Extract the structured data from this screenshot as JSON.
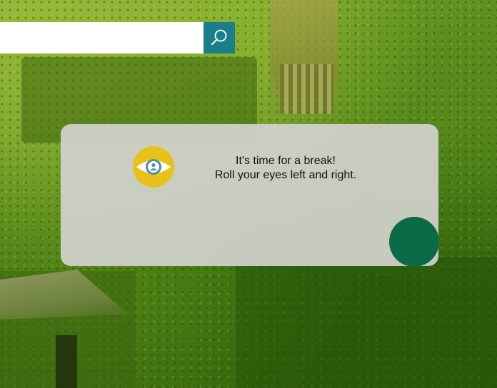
{
  "theme": {
    "search_button_color": "#1a7f8a",
    "eye_icon_ring_color": "#e8c21a",
    "eye_icon_iris_color": "#4b8fa8",
    "progress_dot_color": "#0b6b47"
  },
  "search": {
    "value": "",
    "placeholder": "",
    "button_icon": "search-icon"
  },
  "break_card": {
    "icon": "eye-person-icon",
    "line1": "It's time for a break!",
    "line2": "Roll your eyes left and right."
  }
}
